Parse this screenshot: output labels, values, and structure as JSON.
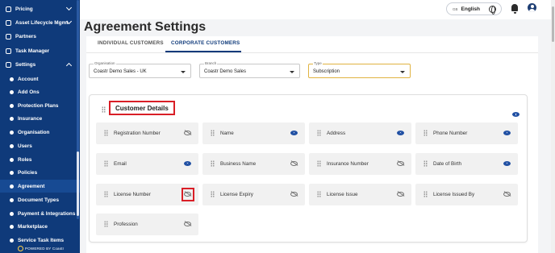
{
  "sidebar": {
    "items": [
      {
        "label": "Pricing",
        "icon": "tag-icon",
        "expand": "down"
      },
      {
        "label": "Asset Lifecycle Mgmt",
        "icon": "asset-icon",
        "expand": "down"
      },
      {
        "label": "Partners",
        "icon": "handshake-icon"
      },
      {
        "label": "Task Manager",
        "icon": "task-icon"
      },
      {
        "label": "Settings",
        "icon": "gear-icon",
        "expand": "up"
      }
    ],
    "children": [
      "Account",
      "Add Ons",
      "Protection Plans",
      "Insurance",
      "Organisation",
      "Users",
      "Roles",
      "Policies",
      "Agreement",
      "Document Types",
      "Payment & Integrations",
      "Marketplace",
      "Service Task Items"
    ],
    "active_child": "Agreement",
    "powered_by": "POWERED BY Coastr"
  },
  "topbar": {
    "language_code": "GB",
    "language": "English"
  },
  "page_title": "Agreement Settings",
  "tabs": [
    {
      "label": "INDIVIDUAL CUSTOMERS",
      "active": false
    },
    {
      "label": "CORPORATE CUSTOMERS",
      "active": true
    }
  ],
  "filters": {
    "organisation": {
      "label": "Organisation",
      "value": "Coastr Demo Sales - UK"
    },
    "branch": {
      "label": "Branch",
      "value": "Coastr Demo Sales"
    },
    "type": {
      "label": "Type",
      "value": "Subscription"
    }
  },
  "section": {
    "title": "Customer Details",
    "visible": true,
    "fields": [
      {
        "label": "Registration Number",
        "visible": false
      },
      {
        "label": "Name",
        "visible": true
      },
      {
        "label": "Address",
        "visible": true
      },
      {
        "label": "Phone Number",
        "visible": true
      },
      {
        "label": "Email",
        "visible": true
      },
      {
        "label": "Business Name",
        "visible": false
      },
      {
        "label": "Insurance Number",
        "visible": false
      },
      {
        "label": "Date of Birth",
        "visible": true
      },
      {
        "label": "License Number",
        "visible": false
      },
      {
        "label": "License Expiry",
        "visible": false
      },
      {
        "label": "License Issue",
        "visible": false
      },
      {
        "label": "License Issued By",
        "visible": false
      },
      {
        "label": "Profession",
        "visible": false
      }
    ]
  },
  "colors": {
    "sidebar_bg": "#0f3a7a",
    "accent": "#0f3a7a",
    "highlight": "#d91e26",
    "type_border": "#e0b341"
  }
}
